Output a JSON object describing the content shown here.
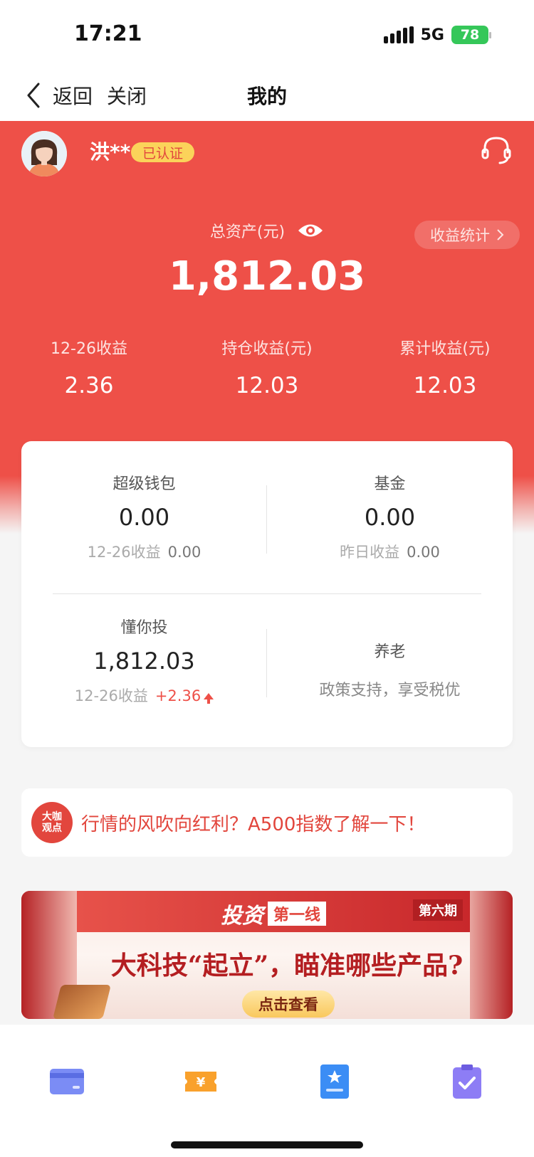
{
  "status_bar": {
    "time": "17:21",
    "network": "5G",
    "battery": "78"
  },
  "nav": {
    "back_label": "返回",
    "close_label": "关闭",
    "title": "我的"
  },
  "user": {
    "name": "洪**",
    "verified_label": "已认证"
  },
  "assets": {
    "total_label": "总资产(元)",
    "total_value": "1,812.03",
    "stats_button_label": "收益统计",
    "summary": [
      {
        "label": "12-26收益",
        "value": "2.36"
      },
      {
        "label": "持仓收益(元)",
        "value": "12.03"
      },
      {
        "label": "累计收益(元)",
        "value": "12.03"
      }
    ]
  },
  "card": {
    "super_wallet": {
      "title": "超级钱包",
      "value": "0.00",
      "sub_label": "12-26收益",
      "sub_value": "0.00"
    },
    "fund": {
      "title": "基金",
      "value": "0.00",
      "sub_label": "昨日收益",
      "sub_value": "0.00"
    },
    "dongnitou": {
      "title": "懂你投",
      "value": "1,812.03",
      "sub_label": "12-26收益",
      "sub_value": "+2.36"
    },
    "pension": {
      "title": "养老",
      "desc": "政策支持，享受税优"
    }
  },
  "news": {
    "badge_line1": "大咖",
    "badge_line2": "观点",
    "text": "行情的风吹向红利？A500指数了解一下！"
  },
  "banner": {
    "brand": "投资",
    "brand_tag": "第一线",
    "issue": "第六期",
    "headline": "大科技“起立”，瞄准哪些产品?",
    "cta": "点击查看"
  },
  "shortcuts": [
    {
      "icon": "card-icon"
    },
    {
      "icon": "coupon-icon"
    },
    {
      "icon": "profile-certificate-icon"
    },
    {
      "icon": "clipboard-check-icon"
    }
  ],
  "colors": {
    "brand_red": "#ee5048",
    "badge_yellow": "#fbd35a",
    "battery_green": "#35c759"
  }
}
